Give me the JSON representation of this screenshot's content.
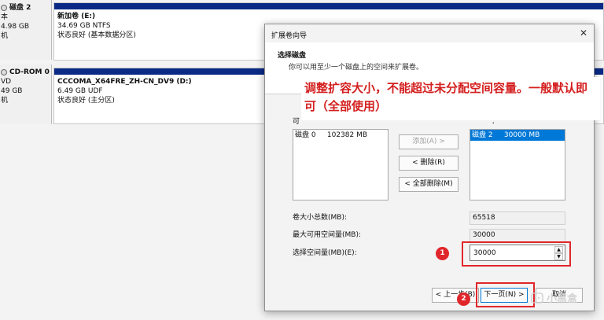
{
  "disks": [
    {
      "name": "磁盘 2",
      "lines": [
        "本",
        "4.98 GB",
        "机"
      ]
    },
    {
      "name": "CD-ROM 0",
      "lines": [
        "VD",
        "49 GB",
        "机"
      ]
    }
  ],
  "volumes": [
    {
      "title": "新加卷 (E:)",
      "size": "34.69 GB NTFS",
      "status": "状态良好 (基本数据分区)"
    },
    {
      "title": "CCCOMA_X64FRE_ZH-CN_DV9 (D:)",
      "size": "6.49 GB UDF",
      "status": "状态良好 (主分区)"
    }
  ],
  "dialog": {
    "title": "扩展卷向导",
    "close": "✕",
    "header_title": "选择磁盘",
    "header_sub": "你可以用至少一个磁盘上的空间来扩展卷。",
    "available_label": "可",
    "selected_label": "：",
    "available_items": [
      "磁盘 0     102382 MB"
    ],
    "selected_items": [
      "磁盘 2     30000 MB"
    ],
    "add_btn": "添加(A) >",
    "remove_btn": "< 删除(R)",
    "remove_all_btn": "< 全部删除(M)",
    "total_label": "卷大小总数(MB):",
    "total_value": "65518",
    "max_label": "最大可用空间量(MB):",
    "max_value": "30000",
    "select_label": "选择空间量(MB)(E):",
    "select_value": "30000",
    "back_btn": "< 上一步(B)",
    "next_btn": "下一页(N) >",
    "cancel_btn": "取消"
  },
  "annotation": {
    "callout": "调整扩容大小，不能超过未分配空间容量。一般默认即可（全部使用）",
    "marker1": "1",
    "marker2": "2"
  },
  "watermark": {
    "text": "小黑盒"
  },
  "colors": {
    "annotation_red": "#e0262b",
    "volume_bar": "#0a2a86",
    "selection": "#0078d7"
  }
}
